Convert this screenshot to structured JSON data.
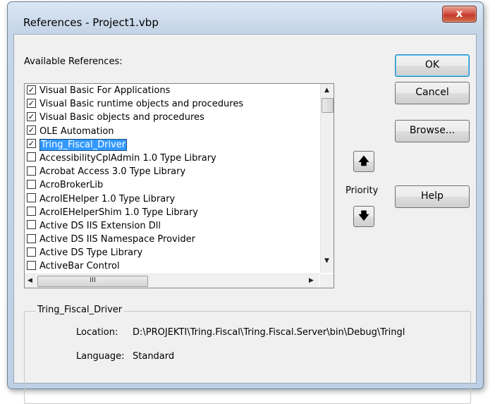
{
  "window": {
    "title": "References - Project1.vbp",
    "close_glyph": "x"
  },
  "available_label": "Available References:",
  "references": [
    {
      "label": "Visual Basic For Applications",
      "checked": true,
      "selected": false
    },
    {
      "label": "Visual Basic runtime objects and procedures",
      "checked": true,
      "selected": false
    },
    {
      "label": "Visual Basic objects and procedures",
      "checked": true,
      "selected": false
    },
    {
      "label": "OLE Automation",
      "checked": true,
      "selected": false
    },
    {
      "label": "Tring_Fiscal_Driver",
      "checked": true,
      "selected": true
    },
    {
      "label": "AccessibilityCplAdmin 1.0 Type Library",
      "checked": false,
      "selected": false
    },
    {
      "label": "Acrobat Access 3.0 Type Library",
      "checked": false,
      "selected": false
    },
    {
      "label": "AcroBrokerLib",
      "checked": false,
      "selected": false
    },
    {
      "label": "AcroIEHelper 1.0 Type Library",
      "checked": false,
      "selected": false
    },
    {
      "label": "AcroIEHelperShim 1.0 Type Library",
      "checked": false,
      "selected": false
    },
    {
      "label": "Active DS IIS Extension Dll",
      "checked": false,
      "selected": false
    },
    {
      "label": "Active DS IIS Namespace Provider",
      "checked": false,
      "selected": false
    },
    {
      "label": "Active DS Type Library",
      "checked": false,
      "selected": false
    },
    {
      "label": "ActiveBar Control",
      "checked": false,
      "selected": false
    }
  ],
  "scroll": {
    "up_glyph": "▲",
    "down_glyph": "▼",
    "left_glyph": "◀",
    "right_glyph": "▶",
    "hthumb_grip": "III"
  },
  "buttons": {
    "ok": "OK",
    "cancel": "Cancel",
    "browse": "Browse...",
    "help": "Help"
  },
  "priority": {
    "label": "Priority",
    "up_glyph": "🡅",
    "down_glyph": "🡇"
  },
  "details": {
    "group_title": "Tring_Fiscal_Driver",
    "location_label": "Location:",
    "location_value": "D:\\PROJEKTI\\Tring.Fiscal\\Tring.Fiscal.Server\\bin\\Debug\\Tringl",
    "language_label": "Language:",
    "language_value": "Standard"
  },
  "colors": {
    "selection": "#3399ff",
    "close_button": "#c13a2c",
    "dialog_face": "#f0f0f0"
  }
}
